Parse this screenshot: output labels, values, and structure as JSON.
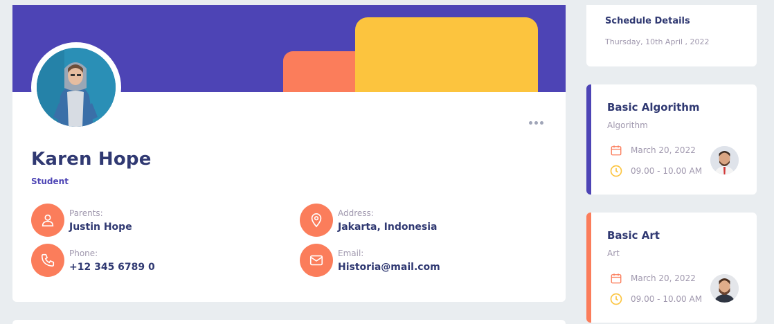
{
  "profile": {
    "name": "Karen Hope",
    "role": "Student",
    "colors": {
      "banner": "#4d44b5",
      "orange": "#fb7d5b",
      "yellow": "#fcc43e",
      "text": "#303972"
    },
    "fields": {
      "parents": {
        "label": "Parents:",
        "value": "Justin Hope",
        "icon": "user-icon"
      },
      "address": {
        "label": "Address:",
        "value": "Jakarta, Indonesia",
        "icon": "location-pin-icon"
      },
      "phone": {
        "label": "Phone:",
        "value": "+12 345 6789 0",
        "icon": "phone-icon"
      },
      "email": {
        "label": "Email:",
        "value": "Historia@mail.com",
        "icon": "mail-icon"
      }
    }
  },
  "schedule": {
    "title": "Schedule Details",
    "date": "Thursday, 10th April , 2022",
    "lessons": [
      {
        "title": "Basic Algorithm",
        "subject": "Algorithm",
        "date": "March 20, 2022",
        "time": "09.00 - 10.00 AM",
        "accent": "#4d44b5"
      },
      {
        "title": "Basic Art",
        "subject": "Art",
        "date": "March 20, 2022",
        "time": "09.00 - 10.00 AM",
        "accent": "#fb7d5b"
      }
    ]
  }
}
